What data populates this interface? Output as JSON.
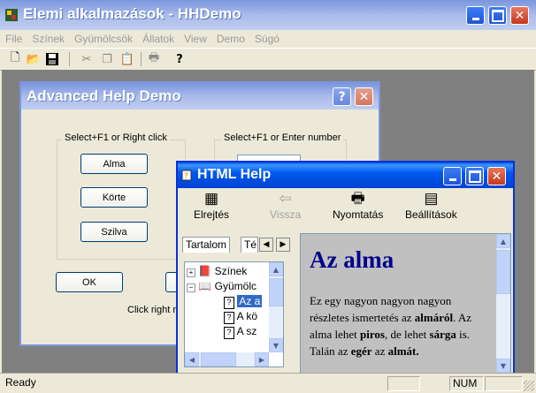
{
  "app": {
    "title": "Elemi alkalmazások - HHDemo",
    "menu": [
      "File",
      "Színek",
      "Gyümölcsök",
      "Állatok",
      "View",
      "Demo",
      "Súgó"
    ],
    "toolbar_icons": [
      "new-icon",
      "open-icon",
      "save-icon",
      "cut-icon",
      "copy-icon",
      "paste-icon",
      "print-icon",
      "help-icon"
    ],
    "status_text": "Ready",
    "status_num": "NUM"
  },
  "dialog": {
    "title": "Advanced Help Demo",
    "group1_label": "Select+F1 or Right click",
    "group2_label": "Select+F1 or Enter number",
    "btn_alma": "Alma",
    "btn_korte": "Körte",
    "btn_szilva": "Szilva",
    "btn_ok": "OK",
    "hint": "Click right m"
  },
  "help": {
    "title": "HTML Help",
    "tools": [
      {
        "label": "Elrejtés",
        "icon": "hide-icon"
      },
      {
        "label": "Vissza",
        "icon": "back-icon"
      },
      {
        "label": "Nyomtatás",
        "icon": "print-icon"
      },
      {
        "label": "Beállítások",
        "icon": "options-icon"
      }
    ],
    "tab_contents": "Tartalom",
    "tab_index": "Té",
    "tree": {
      "colors": "Színek",
      "fruits": "Gyümölc",
      "item1": "Az a",
      "item2": "A kö",
      "item3": "A sz"
    },
    "heading": "Az alma",
    "para": {
      "t1": "Ez egy nagyon nagyon nagyon részletes ismertetés az ",
      "b1": "almáról",
      "t2": ". Az alma lehet ",
      "b2": "piros",
      "t3": ", de lehet ",
      "b3": "sárga",
      "t4": " is.   Talán az ",
      "b4": "egér",
      "t5": "  az ",
      "b5": "almát."
    }
  },
  "colors": {
    "xp_blue": "#0058ee",
    "inactive_title": "#7a96df",
    "heading": "#00008b"
  }
}
